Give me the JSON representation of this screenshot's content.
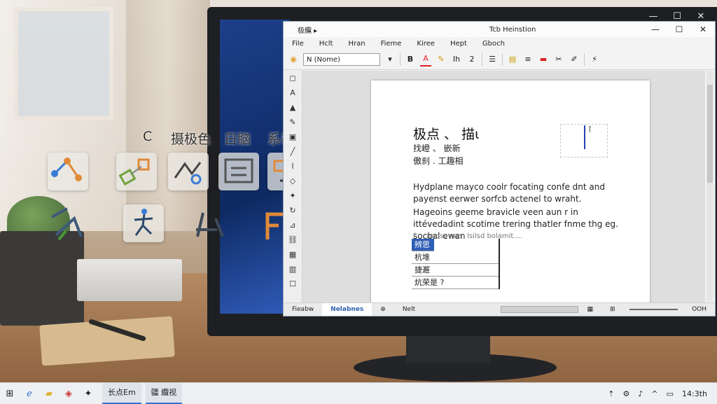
{
  "window": {
    "title_left": "极纜 ▸",
    "title_center": "Tcb Heinstion",
    "minimize": "—",
    "maximize": "☐",
    "close": "✕"
  },
  "outer_controls": {
    "minimize": "—",
    "maximize": "☐",
    "close": "✕"
  },
  "menu": [
    "File",
    "Hclt",
    "Hran",
    "Fieme",
    "Kiree",
    "Hept",
    "Gboch"
  ],
  "toolbar": {
    "font_name": "N (Nome)",
    "bold": "B",
    "font_color": "A",
    "highlight": "✎",
    "style": "Ih",
    "num": "2"
  },
  "overlay": {
    "labels": [
      "C",
      "摄极色",
      "日脑",
      "系极色"
    ]
  },
  "document": {
    "title": "极点 、 描ι",
    "sub1": "找嶝 、 嵌新",
    "sub2": "傲刹 .  工趣相",
    "frame_label": "l̊",
    "para1": "Hydplane mayco coolr focating confe dnt and payenst eerwer sorfcb actenel to wraht.",
    "para2": "Hageoins geeme bravicle veen aun r in ittévedadint scotime trering thatler fnme thg eg. socbal ewan",
    "para3": "f ... nnoss nam lsilsd  bolamit....",
    "list": [
      "辨思",
      "杭堆",
      "捷邂",
      "炕荣是 ?"
    ]
  },
  "status": {
    "tab1": "Fieabw",
    "tab2": "Nelabnes",
    "tab3": "Nelt",
    "zoom_label": "OOH"
  },
  "taskbar": {
    "task1": "长点Em",
    "task2": "疆 纜视",
    "clock": "14:3th"
  },
  "colors": {
    "accent": "#2f5fb6",
    "wallpaper": "#1d3f8a"
  }
}
